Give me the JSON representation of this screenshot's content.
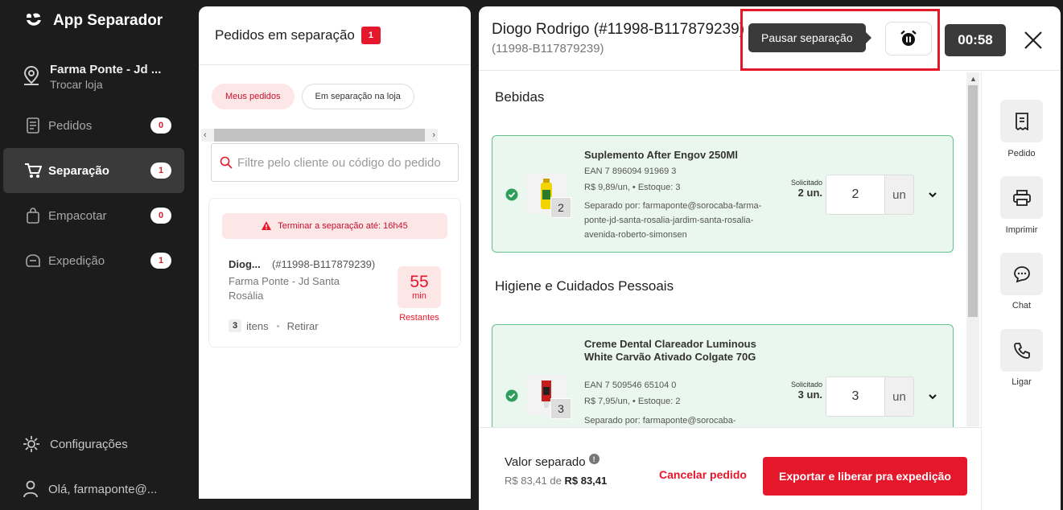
{
  "app": {
    "title": "App Separador"
  },
  "store": {
    "name": "Farma Ponte - Jd ...",
    "switch_label": "Trocar loja"
  },
  "nav": [
    {
      "label": "Pedidos",
      "count": "0",
      "icon": "receipt-icon"
    },
    {
      "label": "Separação",
      "count": "1",
      "icon": "cart-icon",
      "active": true
    },
    {
      "label": "Empacotar",
      "count": "0",
      "icon": "bag-icon"
    },
    {
      "label": "Expedição",
      "count": "1",
      "icon": "box-icon"
    }
  ],
  "footer_nav": {
    "settings": "Configurações",
    "user": "Olá, farmaponte@..."
  },
  "orders": {
    "title": "Pedidos em separação",
    "count": "1",
    "tabs": [
      "Meus pedidos",
      "Em separação na loja"
    ],
    "filter_placeholder": "Filtre pelo cliente ou código do pedido",
    "card": {
      "deadline": "Terminar a separação até: 16h45",
      "customer": "Diog...",
      "code": "(#11998-B117879239)",
      "store": "Farma Ponte - Jd Santa Rosália",
      "timer_value": "55",
      "timer_unit": "min",
      "timer_label": "Restantes",
      "items_count": "3",
      "items_label": "itens",
      "delivery": "Retirar"
    }
  },
  "detail": {
    "customer": "Diogo Rodrigo  (#11998-B117879239)",
    "code": "(11998-B117879239)",
    "tooltip": "Pausar separação",
    "clock": "00:58",
    "categories": [
      {
        "name": "Bebidas",
        "items": [
          {
            "name": "Suplemento After Engov 250Ml",
            "ean": "EAN 7 896094 91969 3",
            "price": "R$ 9,89/un, • Estoque: 3",
            "separated_by": "Separado por: farmaponte@sorocaba-farma-ponte-jd-santa-rosalia-jardim-santa-rosalia-avenida-roberto-simonsen",
            "qty_badge": "2",
            "requested_label": "Solicitado",
            "requested_value": "2 un.",
            "qty": "2",
            "unit": "un"
          }
        ]
      },
      {
        "name": "Higiene e Cuidados Pessoais",
        "items": [
          {
            "name": "Creme Dental Clareador Luminous White Carvão Ativado Colgate 70G",
            "ean": "EAN 7 509546 65104 0",
            "price": "R$ 7,95/un, • Estoque: 2",
            "separated_by": "Separado por: farmaponte@sorocaba-",
            "qty_badge": "3",
            "requested_label": "Solicitado",
            "requested_value": "3 un.",
            "qty": "3",
            "unit": "un"
          }
        ]
      }
    ],
    "actions": [
      "Pedido",
      "Imprimir",
      "Chat",
      "Ligar"
    ],
    "footer": {
      "label": "Valor separado",
      "value_separated": "R$ 83,41",
      "value_of": "de",
      "value_total": "R$ 83,41",
      "cancel": "Cancelar pedido",
      "export": "Exportar e liberar pra expedição"
    }
  },
  "colors": {
    "accent": "#e4172b",
    "sidebar": "#1c1c1c",
    "success": "#65c18c"
  }
}
